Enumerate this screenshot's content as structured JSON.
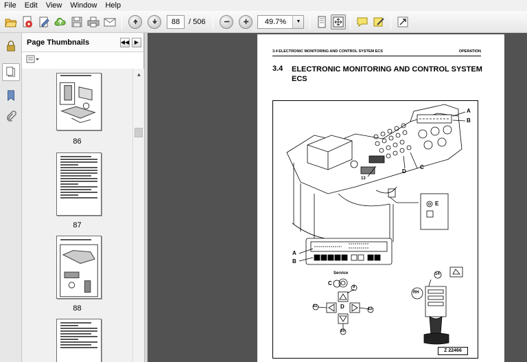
{
  "menu": {
    "items": [
      "File",
      "Edit",
      "View",
      "Window",
      "Help"
    ]
  },
  "toolbar": {
    "current_page": "88",
    "total_pages": "/ 506",
    "zoom": "49.7%",
    "icons": [
      "open-icon",
      "create-pdf-icon",
      "edit-icon",
      "cloud-upload-icon",
      "save-icon",
      "print-icon",
      "email-icon",
      "previous-page-icon",
      "next-page-icon",
      "zoom-out-icon",
      "zoom-in-icon",
      "fit-page-icon",
      "fit-width-icon",
      "comment-icon",
      "sign-icon",
      "expand-icon"
    ]
  },
  "thumbnails": {
    "title": "Page Thumbnails",
    "pages": [
      {
        "label": "86"
      },
      {
        "label": "87"
      },
      {
        "label": "88"
      }
    ]
  },
  "document": {
    "header_left": "3.4 ELECTRONIC MONITORING AND CONTROL SYSTEM ECS",
    "header_right": "OPERATION",
    "section_number": "3.4",
    "section_title": "ELECTRONIC MONITORING AND CONTROL SYSTEM ECS",
    "figure": {
      "callouts": [
        "A",
        "B",
        "13",
        "D",
        "C",
        "E",
        "A",
        "B",
        "Service",
        "C",
        "9",
        "11",
        "D",
        "12",
        "10",
        "14",
        "RH"
      ],
      "code": "Z 22466"
    }
  },
  "colors": {
    "doc_background": "#525252",
    "panel_background": "#f0f0f0"
  }
}
